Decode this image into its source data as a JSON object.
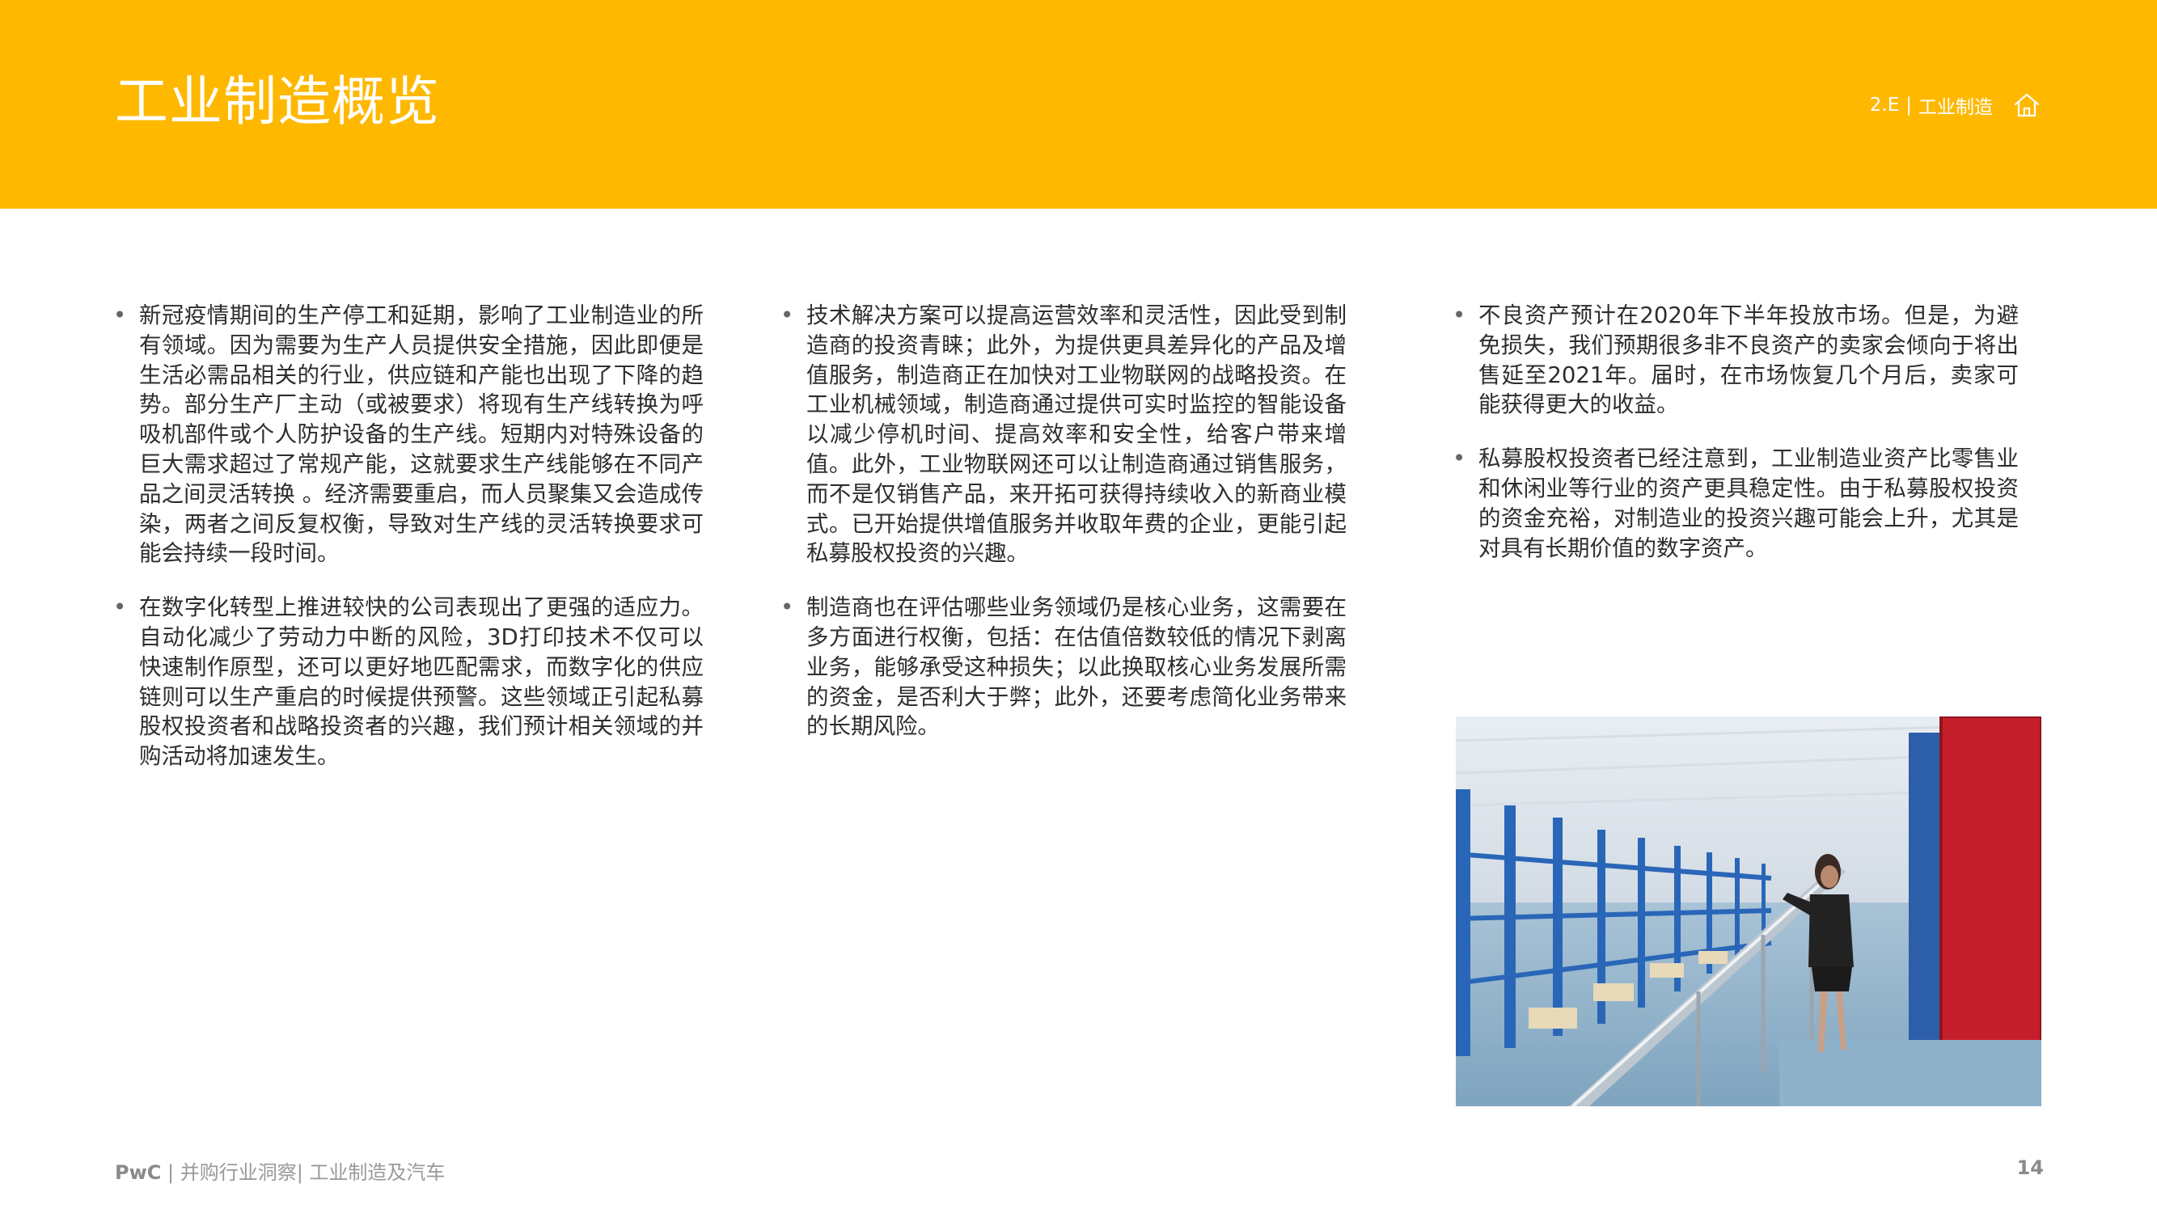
{
  "header": {
    "title": "工业制造概览",
    "breadcrumb_code": "2.E",
    "breadcrumb_sep": "|",
    "breadcrumb_label": "工业制造",
    "home_icon": "home-icon",
    "bg_color": "#FFB800"
  },
  "columns": [
    {
      "bullets": [
        "新冠疫情期间的生产停工和延期，影响了工业制造业的所有领域。因为需要为生产人员提供安全措施，因此即便是生活必需品相关的行业，供应链和产能也出现了下降的趋势。部分生产厂主动（或被要求）将现有生产线转换为呼吸机部件或个人防护设备的生产线。短期内对特殊设备的巨大需求超过了常规产能，这就要求生产线能够在不同产品之间灵活转换 。经济需要重启，而人员聚集又会造成传染，两者之间反复权衡，导致对生产线的灵活转换要求可能会持续一段时间。",
        "在数字化转型上推进较快的公司表现出了更强的适应力。自动化减少了劳动力中断的风险，3D打印技术不仅可以快速制作原型，还可以更好地匹配需求，而数字化的供应链则可以生产重启的时候提供预警。这些领域正引起私募股权投资者和战略投资者的兴趣，我们预计相关领域的并购活动将加速发生。"
      ]
    },
    {
      "bullets": [
        "技术解决方案可以提高运营效率和灵活性，因此受到制造商的投资青睐；此外，为提供更具差异化的产品及增值服务，制造商正在加快对工业物联网的战略投资。在工业机械领域，制造商通过提供可实时监控的智能设备以减少停机时间、提高效率和安全性，给客户带来增值。此外，工业物联网还可以让制造商通过销售服务，而不是仅销售产品，来开拓可获得持续收入的新商业模式。已开始提供增值服务并收取年费的企业，更能引起私募股权投资的兴趣。",
        "制造商也在评估哪些业务领域仍是核心业务，这需要在多方面进行权衡，包括：在估值倍数较低的情况下剥离业务，能够承受这种损失；以此换取核心业务发展所需的资金，是否利大于弊；此外，还要考虑简化业务带来的长期风险。"
      ]
    },
    {
      "bullets": [
        "不良资产预计在2020年下半年投放市场。但是，为避免损失，我们预期很多非不良资产的卖家会倾向于将出售延至2021年。届时，在市场恢复几个月后，卖家可能获得更大的收益。",
        "私募股权投资者已经注意到，工业制造业资产比零售业和休闲业等行业的资产更具稳定性。由于私募股权投资的资金充裕，对制造业的投资兴趣可能会上升，尤其是对具有长期价值的数字资产。"
      ]
    }
  ],
  "footer": {
    "brand": "PwC",
    "text": " | 并购行业洞察| 工业制造及汽车",
    "page_number": "14"
  }
}
